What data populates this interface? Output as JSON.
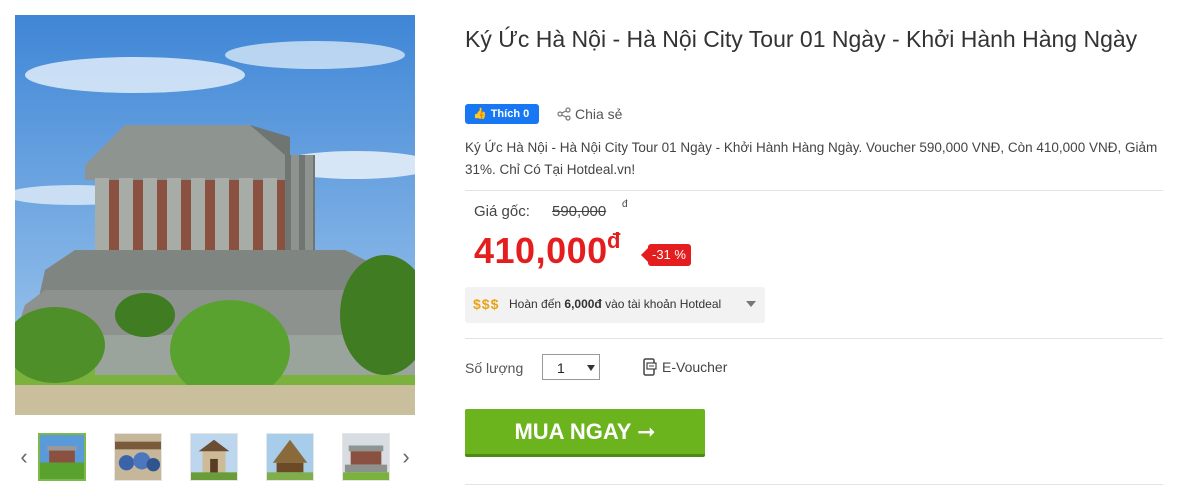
{
  "product": {
    "title": "Ký Ức Hà Nội - Hà Nội City Tour 01 Ngày - Khởi Hành Hàng Ngày",
    "description": "Ký Ức Hà Nội - Hà Nội City Tour 01 Ngày - Khởi Hành Hàng Ngày. Voucher 590,000 VNĐ, Còn 410,000 VNĐ, Giảm 31%. Chỉ Có Tại Hotdeal.vn!"
  },
  "social": {
    "like_label": "Thích 0",
    "share_label": "Chia sẻ"
  },
  "price": {
    "original_label": "Giá gốc:",
    "original_value": "590,000",
    "currency": "đ",
    "sale_value": "410,000",
    "discount": "-31 %"
  },
  "cashback": {
    "coins": "$$$",
    "text_before": "Hoàn đến ",
    "amount": "6,000đ",
    "text_after": " vào tài khoản Hotdeal"
  },
  "quantity": {
    "label": "Số lượng",
    "value": "1"
  },
  "voucher_type": "E-Voucher",
  "buy_button": "MUA NGAY ➞",
  "gallery": {
    "prev_icon": "‹",
    "next_icon": "›",
    "thumbnail_count": 5
  },
  "colors": {
    "price_red": "#e41e1e",
    "buy_green": "#6cb41e",
    "facebook_blue": "#1877f2"
  }
}
